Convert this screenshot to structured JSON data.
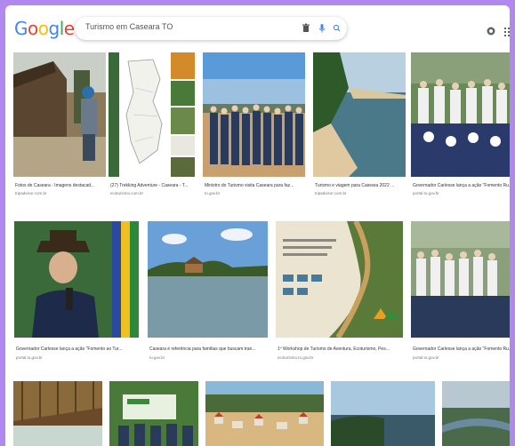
{
  "logo": {
    "letters": [
      "G",
      "o",
      "o",
      "g",
      "l",
      "e"
    ],
    "colors": [
      "#4285F4",
      "#EA4335",
      "#FBBC05",
      "#4285F4",
      "#34A853",
      "#EA4335"
    ]
  },
  "search": {
    "query": "Turismo em Caseara TO"
  },
  "icons": {
    "clear": "trash-icon",
    "voice": "mic-icon",
    "lens": "search-icon",
    "settings": "gear-icon",
    "apps": "apps-grid-icon"
  },
  "results": [
    {
      "caption": "Fotos de Caseara - Imagens destacad...",
      "source": "tripadvisor.com.br"
    },
    {
      "caption": "(27) Trekking Adventure - Caseara - T...",
      "source": "ecoturismo.com.br"
    },
    {
      "caption": "Ministro do Turismo visita Caseara para faz...",
      "source": "to.gov.br"
    },
    {
      "caption": "Turismo e viagem para Caseara 2022 ...",
      "source": "tripadvisor.com.br"
    },
    {
      "caption": "Governador Carlesse lança a ação \"Fomento Ru...",
      "source": "portal.to.gov.br"
    },
    {
      "caption": "Governador Carlesse lança a ação \"Fomento ao Tur...",
      "source": "portal.to.gov.br"
    },
    {
      "caption": "Caseara é referência para famílias que buscam tran...",
      "source": "to.gov.br"
    },
    {
      "caption": "1º Workshop de Turismo de Aventura, Ecoturismo, Pes...",
      "source": "ecoturismo.to.gov.br"
    },
    {
      "caption": "Governador Carlesse lança a ação \"Fomento Ru...",
      "source": "portal.to.gov.br"
    }
  ]
}
